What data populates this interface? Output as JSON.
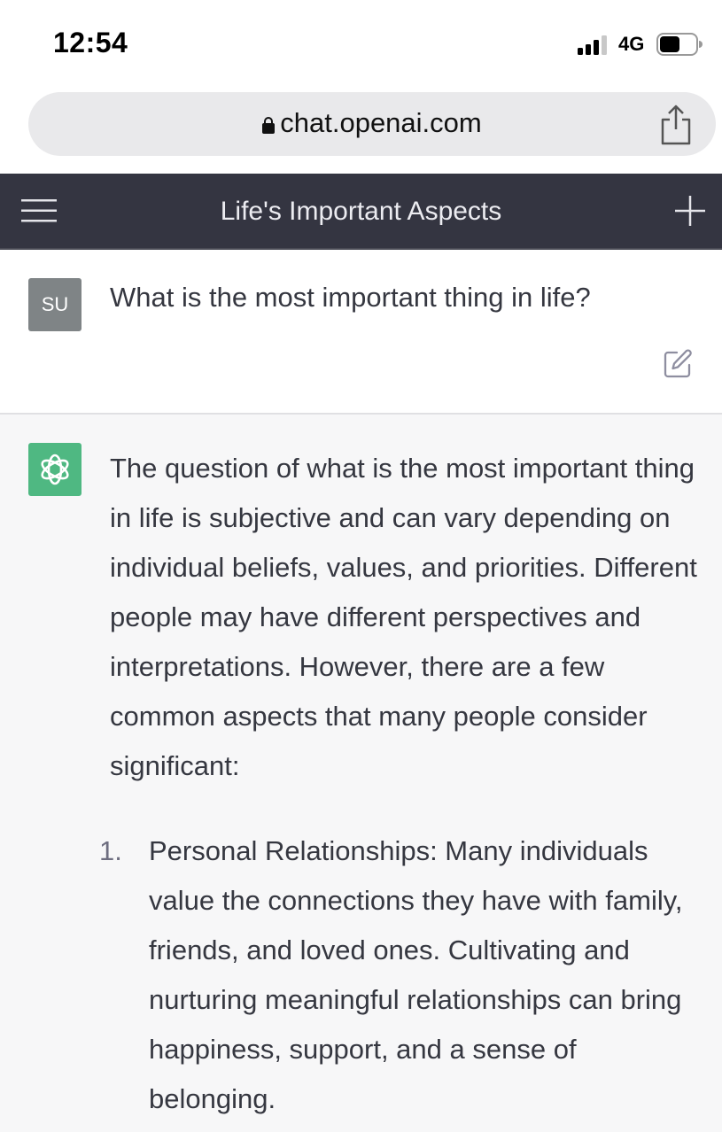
{
  "status_bar": {
    "time": "12:54",
    "network": "4G"
  },
  "browser": {
    "url": "chat.openai.com"
  },
  "header": {
    "title": "Life's Important Aspects"
  },
  "conversation": {
    "user": {
      "avatar_initials": "SU",
      "message": "What is the most important thing in life?"
    },
    "assistant": {
      "intro": "The question of what is the most important thing in life is subjective and can vary depending on individual beliefs, values, and priorities. Different people may have different perspectives and interpretations. However, there are a few common aspects that many people consider significant:",
      "list": [
        {
          "number": "1.",
          "text": "Personal Relationships: Many individuals value the connections they have with family, friends, and loved ones. Cultivating and nurturing meaningful relationships can bring happiness, support, and a sense of belonging."
        }
      ]
    }
  },
  "colors": {
    "nav_bg": "#343541",
    "assistant_bg": "#f7f7f8",
    "bot_avatar": "#4fb882",
    "user_avatar": "#7f8486"
  },
  "icons": [
    "signal-icon",
    "battery-icon",
    "lock-icon",
    "share-icon",
    "menu-icon",
    "plus-icon",
    "edit-icon",
    "openai-logo-icon"
  ]
}
